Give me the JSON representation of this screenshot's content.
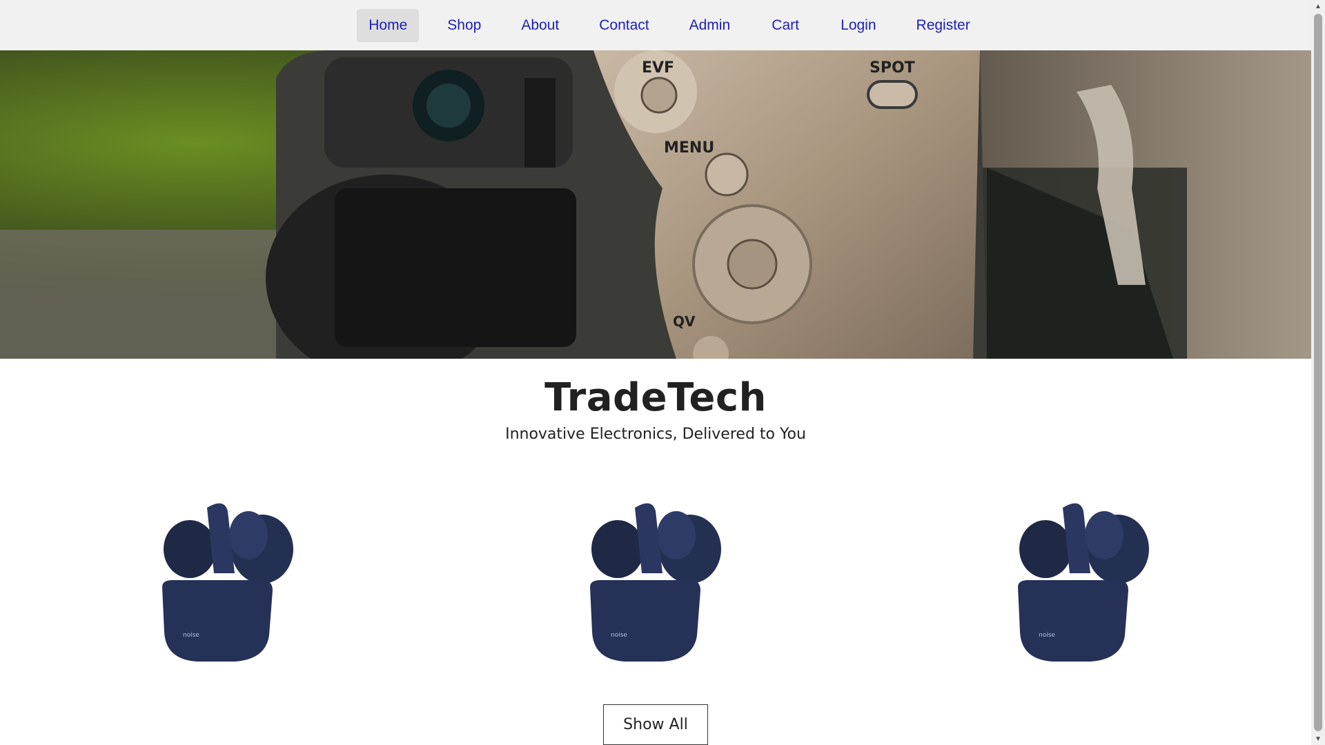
{
  "nav": {
    "items": [
      {
        "label": "Home",
        "active": true
      },
      {
        "label": "Shop",
        "active": false
      },
      {
        "label": "About",
        "active": false
      },
      {
        "label": "Contact",
        "active": false
      },
      {
        "label": "Admin",
        "active": false
      },
      {
        "label": "Cart",
        "active": false
      },
      {
        "label": "Login",
        "active": false
      },
      {
        "label": "Register",
        "active": false
      }
    ]
  },
  "hero": {
    "camera_labels": {
      "evf": "EVF",
      "spot": "SPOT",
      "menu": "MENU",
      "qv": "QV"
    }
  },
  "brand": {
    "title": "TradeTech",
    "tagline": "Innovative Electronics, Delivered to You"
  },
  "products": [
    {
      "brand_mark": "noise"
    },
    {
      "brand_mark": "noise"
    },
    {
      "brand_mark": "noise"
    }
  ],
  "actions": {
    "show_all_label": "Show All"
  },
  "colors": {
    "nav_bg": "#f1f1f1",
    "nav_link": "#1d1db8",
    "active_bg": "#dedede",
    "title": "#212121",
    "earbuds": "#243052"
  },
  "icons": {
    "scroll_up": "▲",
    "scroll_down": "▼"
  }
}
